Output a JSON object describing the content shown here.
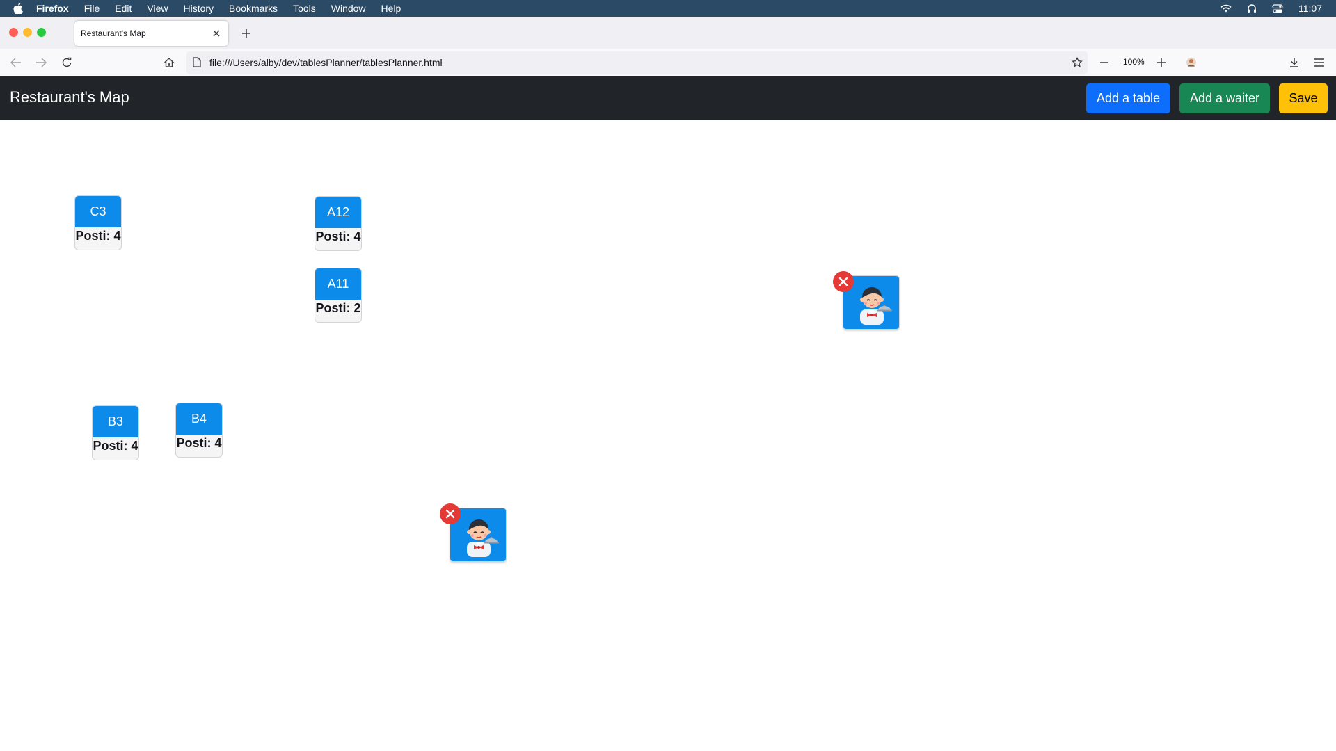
{
  "menubar": {
    "app_name": "Firefox",
    "items": [
      "File",
      "Edit",
      "View",
      "History",
      "Bookmarks",
      "Tools",
      "Window",
      "Help"
    ],
    "clock": "11:07"
  },
  "browser": {
    "tab_title": "Restaurant's Map",
    "url": "file:///Users/alby/dev/tablesPlanner/tablesPlanner.html",
    "zoom": "100%"
  },
  "app": {
    "brand": "Restaurant's Map",
    "buttons": {
      "add_table": "Add a table",
      "add_waiter": "Add a waiter",
      "save": "Save"
    },
    "colors": {
      "navbar": "#212529",
      "primary": "#0d6efd",
      "success": "#198754",
      "warning": "#ffc107",
      "table": "#0d8bea",
      "remove": "#e53935"
    }
  },
  "tables": [
    {
      "name": "C3",
      "seats": "Posti: 4"
    },
    {
      "name": "A12",
      "seats": "Posti: 4"
    },
    {
      "name": "A11",
      "seats": "Posti: 2"
    },
    {
      "name": "B3",
      "seats": "Posti: 4"
    },
    {
      "name": "B4",
      "seats": "Posti: 4"
    }
  ],
  "waiters": [
    {
      "icon": "waiter-avatar-icon",
      "remove_icon": "close-icon"
    },
    {
      "icon": "waiter-avatar-icon",
      "remove_icon": "close-icon"
    }
  ]
}
